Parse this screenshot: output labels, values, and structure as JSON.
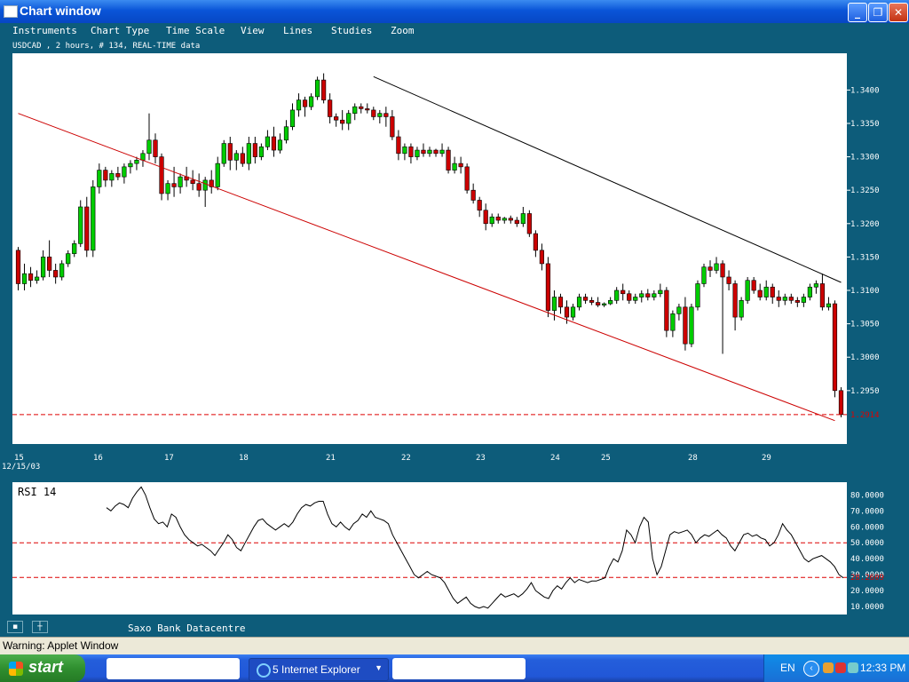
{
  "window": {
    "title": "Chart window",
    "minimize": "_",
    "maximize": "❐",
    "close": "✕"
  },
  "menu": [
    "Instruments",
    "Chart Type",
    "Time Scale",
    "View",
    "Lines",
    "Studies",
    "Zoom"
  ],
  "chart_info": "USDCAD , 2 hours, # 134, REAL-TIME data",
  "chart_data": [
    {
      "type": "candlestick",
      "instrument": "USDCAD",
      "interval": "2 hours",
      "bars": 134,
      "ylim": [
        1.287,
        1.3455
      ],
      "y_ticks": [
        "1.3400",
        "1.3350",
        "1.3300",
        "1.3250",
        "1.3200",
        "1.3150",
        "1.3100",
        "1.3050",
        "1.3000",
        "1.2950"
      ],
      "current_price": "1.2914",
      "x_ticks": [
        "15",
        "16",
        "17",
        "18",
        "21",
        "22",
        "23",
        "24",
        "25",
        "28",
        "29"
      ],
      "x_start_label": "12/15/03",
      "trend_lines": [
        {
          "color": "#000000",
          "from": [
            57,
            1.342
          ],
          "to": [
            132,
            1.3112
          ]
        },
        {
          "color": "#cc0000",
          "from": [
            0,
            1.3365
          ],
          "to": [
            131,
            1.2905
          ]
        }
      ],
      "ohlc": [
        [
          1.316,
          1.3165,
          1.31,
          1.311
        ],
        [
          1.311,
          1.314,
          1.31,
          1.3125
        ],
        [
          1.3125,
          1.3135,
          1.3105,
          1.3115
        ],
        [
          1.3115,
          1.313,
          1.311,
          1.312
        ],
        [
          1.312,
          1.316,
          1.3115,
          1.315
        ],
        [
          1.315,
          1.3175,
          1.312,
          1.313
        ],
        [
          1.313,
          1.314,
          1.311,
          1.312
        ],
        [
          1.312,
          1.3145,
          1.3115,
          1.314
        ],
        [
          1.314,
          1.316,
          1.3135,
          1.3155
        ],
        [
          1.3155,
          1.3175,
          1.315,
          1.317
        ],
        [
          1.317,
          1.3235,
          1.3165,
          1.3225
        ],
        [
          1.3225,
          1.324,
          1.315,
          1.316
        ],
        [
          1.316,
          1.3265,
          1.315,
          1.3255
        ],
        [
          1.3255,
          1.329,
          1.3245,
          1.328
        ],
        [
          1.328,
          1.3285,
          1.3255,
          1.3265
        ],
        [
          1.3265,
          1.328,
          1.3255,
          1.3275
        ],
        [
          1.3275,
          1.3285,
          1.3265,
          1.327
        ],
        [
          1.327,
          1.329,
          1.326,
          1.3285
        ],
        [
          1.3285,
          1.3295,
          1.3275,
          1.329
        ],
        [
          1.329,
          1.33,
          1.328,
          1.3295
        ],
        [
          1.3295,
          1.331,
          1.3285,
          1.3305
        ],
        [
          1.3305,
          1.3365,
          1.3295,
          1.3325
        ],
        [
          1.3325,
          1.3335,
          1.329,
          1.33
        ],
        [
          1.33,
          1.3305,
          1.3235,
          1.3245
        ],
        [
          1.3245,
          1.3265,
          1.3235,
          1.326
        ],
        [
          1.326,
          1.3285,
          1.324,
          1.3255
        ],
        [
          1.3255,
          1.3275,
          1.3245,
          1.327
        ],
        [
          1.327,
          1.3285,
          1.3255,
          1.3265
        ],
        [
          1.3265,
          1.328,
          1.325,
          1.326
        ],
        [
          1.326,
          1.3275,
          1.324,
          1.325
        ],
        [
          1.325,
          1.327,
          1.3225,
          1.3265
        ],
        [
          1.3265,
          1.328,
          1.3245,
          1.3255
        ],
        [
          1.3255,
          1.33,
          1.325,
          1.329
        ],
        [
          1.329,
          1.3325,
          1.3285,
          1.332
        ],
        [
          1.332,
          1.333,
          1.328,
          1.3295
        ],
        [
          1.3295,
          1.331,
          1.328,
          1.3305
        ],
        [
          1.3305,
          1.3315,
          1.3285,
          1.329
        ],
        [
          1.329,
          1.333,
          1.328,
          1.332
        ],
        [
          1.332,
          1.333,
          1.329,
          1.33
        ],
        [
          1.33,
          1.332,
          1.3295,
          1.3315
        ],
        [
          1.3315,
          1.334,
          1.331,
          1.333
        ],
        [
          1.333,
          1.3345,
          1.33,
          1.331
        ],
        [
          1.331,
          1.3335,
          1.3305,
          1.3325
        ],
        [
          1.3325,
          1.3355,
          1.332,
          1.3345
        ],
        [
          1.3345,
          1.338,
          1.334,
          1.337
        ],
        [
          1.337,
          1.3395,
          1.336,
          1.3385
        ],
        [
          1.3385,
          1.339,
          1.336,
          1.3375
        ],
        [
          1.3375,
          1.3395,
          1.337,
          1.339
        ],
        [
          1.339,
          1.342,
          1.3385,
          1.3415
        ],
        [
          1.3415,
          1.3425,
          1.338,
          1.3385
        ],
        [
          1.3385,
          1.3395,
          1.335,
          1.336
        ],
        [
          1.336,
          1.3365,
          1.3345,
          1.3355
        ],
        [
          1.3355,
          1.337,
          1.334,
          1.335
        ],
        [
          1.335,
          1.337,
          1.334,
          1.3365
        ],
        [
          1.3365,
          1.338,
          1.3355,
          1.3375
        ],
        [
          1.3375,
          1.338,
          1.3365,
          1.3372
        ],
        [
          1.3372,
          1.338,
          1.3365,
          1.337
        ],
        [
          1.337,
          1.3375,
          1.3355,
          1.336
        ],
        [
          1.336,
          1.337,
          1.335,
          1.3365
        ],
        [
          1.3365,
          1.3375,
          1.3345,
          1.336
        ],
        [
          1.336,
          1.337,
          1.3325,
          1.333
        ],
        [
          1.333,
          1.334,
          1.3295,
          1.3305
        ],
        [
          1.3305,
          1.332,
          1.3295,
          1.3315
        ],
        [
          1.3315,
          1.332,
          1.329,
          1.33
        ],
        [
          1.33,
          1.3315,
          1.3295,
          1.331
        ],
        [
          1.331,
          1.332,
          1.33,
          1.3305
        ],
        [
          1.3305,
          1.3315,
          1.33,
          1.331
        ],
        [
          1.331,
          1.3312,
          1.33,
          1.3305
        ],
        [
          1.3305,
          1.332,
          1.33,
          1.331
        ],
        [
          1.331,
          1.3315,
          1.3275,
          1.328
        ],
        [
          1.328,
          1.33,
          1.3275,
          1.329
        ],
        [
          1.329,
          1.33,
          1.3275,
          1.3285
        ],
        [
          1.3285,
          1.329,
          1.3245,
          1.325
        ],
        [
          1.325,
          1.326,
          1.323,
          1.3235
        ],
        [
          1.3235,
          1.324,
          1.321,
          1.322
        ],
        [
          1.322,
          1.323,
          1.319,
          1.32
        ],
        [
          1.32,
          1.3215,
          1.3195,
          1.321
        ],
        [
          1.321,
          1.3215,
          1.32,
          1.3205
        ],
        [
          1.3205,
          1.321,
          1.32,
          1.3208
        ],
        [
          1.3208,
          1.3212,
          1.32,
          1.3205
        ],
        [
          1.3205,
          1.321,
          1.3195,
          1.32
        ],
        [
          1.32,
          1.3225,
          1.3195,
          1.3215
        ],
        [
          1.3215,
          1.322,
          1.318,
          1.3185
        ],
        [
          1.3185,
          1.319,
          1.315,
          1.316
        ],
        [
          1.316,
          1.317,
          1.313,
          1.314
        ],
        [
          1.314,
          1.315,
          1.306,
          1.307
        ],
        [
          1.307,
          1.31,
          1.3055,
          1.309
        ],
        [
          1.309,
          1.3095,
          1.3065,
          1.3075
        ],
        [
          1.3075,
          1.3085,
          1.305,
          1.306
        ],
        [
          1.306,
          1.308,
          1.3055,
          1.3075
        ],
        [
          1.3075,
          1.3095,
          1.307,
          1.309
        ],
        [
          1.309,
          1.3095,
          1.308,
          1.3085
        ],
        [
          1.3085,
          1.309,
          1.3078,
          1.3082
        ],
        [
          1.3082,
          1.309,
          1.3075,
          1.3078
        ],
        [
          1.3078,
          1.3082,
          1.3075,
          1.308
        ],
        [
          1.308,
          1.309,
          1.3078,
          1.3085
        ],
        [
          1.3085,
          1.3105,
          1.308,
          1.31
        ],
        [
          1.31,
          1.311,
          1.3085,
          1.3095
        ],
        [
          1.3095,
          1.31,
          1.308,
          1.3085
        ],
        [
          1.3085,
          1.3095,
          1.308,
          1.309
        ],
        [
          1.309,
          1.31,
          1.3082,
          1.3095
        ],
        [
          1.3095,
          1.3102,
          1.3085,
          1.309
        ],
        [
          1.309,
          1.31,
          1.3085,
          1.3095
        ],
        [
          1.3095,
          1.311,
          1.309,
          1.31
        ],
        [
          1.31,
          1.3105,
          1.303,
          1.304
        ],
        [
          1.304,
          1.307,
          1.303,
          1.3065
        ],
        [
          1.3065,
          1.308,
          1.3055,
          1.3075
        ],
        [
          1.3075,
          1.309,
          1.301,
          1.302
        ],
        [
          1.302,
          1.308,
          1.3015,
          1.3075
        ],
        [
          1.3075,
          1.3115,
          1.307,
          1.311
        ],
        [
          1.311,
          1.314,
          1.3105,
          1.3135
        ],
        [
          1.3135,
          1.3145,
          1.312,
          1.313
        ],
        [
          1.313,
          1.315,
          1.3125,
          1.314
        ],
        [
          1.314,
          1.3145,
          1.3005,
          1.312
        ],
        [
          1.312,
          1.313,
          1.31,
          1.311
        ],
        [
          1.311,
          1.3115,
          1.304,
          1.306
        ],
        [
          1.306,
          1.309,
          1.3055,
          1.3085
        ],
        [
          1.3085,
          1.312,
          1.308,
          1.3115
        ],
        [
          1.3115,
          1.312,
          1.3095,
          1.31
        ],
        [
          1.31,
          1.311,
          1.3085,
          1.309
        ],
        [
          1.309,
          1.3115,
          1.3085,
          1.3105
        ],
        [
          1.3105,
          1.311,
          1.308,
          1.309
        ],
        [
          1.309,
          1.31,
          1.3075,
          1.3085
        ],
        [
          1.3085,
          1.3095,
          1.3078,
          1.309
        ],
        [
          1.309,
          1.3095,
          1.308,
          1.3085
        ],
        [
          1.3085,
          1.309,
          1.3075,
          1.3082
        ],
        [
          1.3082,
          1.3095,
          1.3075,
          1.309
        ],
        [
          1.309,
          1.311,
          1.3085,
          1.3105
        ],
        [
          1.3105,
          1.3115,
          1.3095,
          1.311
        ],
        [
          1.311,
          1.3125,
          1.307,
          1.3075
        ],
        [
          1.3075,
          1.309,
          1.307,
          1.308
        ],
        [
          1.308,
          1.3085,
          1.294,
          1.295
        ],
        [
          1.295,
          1.2955,
          1.291,
          1.2914
        ]
      ]
    },
    {
      "type": "line",
      "title": "RSI 14",
      "ylim": [
        5,
        88
      ],
      "y_ticks": [
        "80.0000",
        "70.0000",
        "60.0000",
        "50.0000",
        "40.0000",
        "30.0000",
        "20.0000",
        "10.0000"
      ],
      "reference_levels": [
        50,
        28.2609
      ],
      "current_value": "28.2609",
      "values": [
        72,
        70,
        73,
        75,
        74,
        72,
        78,
        82,
        85,
        80,
        72,
        65,
        62,
        63,
        60,
        68,
        66,
        60,
        55,
        52,
        50,
        48,
        49,
        47,
        45,
        42,
        46,
        50,
        55,
        52,
        47,
        45,
        50,
        55,
        60,
        64,
        65,
        62,
        60,
        58,
        60,
        62,
        60,
        63,
        68,
        72,
        74,
        73,
        75,
        76,
        76,
        68,
        62,
        60,
        63,
        60,
        58,
        62,
        64,
        68,
        66,
        70,
        66,
        65,
        64,
        62,
        55,
        50,
        45,
        40,
        35,
        30,
        28,
        30,
        32,
        30,
        29,
        28,
        25,
        20,
        15,
        12,
        14,
        16,
        12,
        10,
        9,
        10,
        9,
        12,
        15,
        18,
        16,
        17,
        18,
        16,
        18,
        21,
        25,
        20,
        18,
        16,
        15,
        20,
        23,
        21,
        25,
        28,
        25,
        27,
        26,
        25,
        26,
        26,
        27,
        28,
        35,
        40,
        38,
        45,
        58,
        55,
        50,
        60,
        66,
        63,
        40,
        30,
        35,
        45,
        55,
        57,
        56,
        57,
        58,
        55,
        50,
        53,
        55,
        54,
        56,
        58,
        55,
        53,
        48,
        45,
        50,
        55,
        56,
        54,
        55,
        53,
        52,
        48,
        50,
        55,
        62,
        58,
        55,
        50,
        45,
        40,
        38,
        40,
        41,
        42,
        40,
        38,
        35,
        30,
        28
      ]
    }
  ],
  "status": {
    "datacentre": "Saxo Bank Datacentre"
  },
  "warning": "Warning: Applet Window",
  "taskbar": {
    "start": "start",
    "ie_task": "5 Internet Explorer",
    "lang": "EN",
    "clock": "12:33 PM"
  }
}
